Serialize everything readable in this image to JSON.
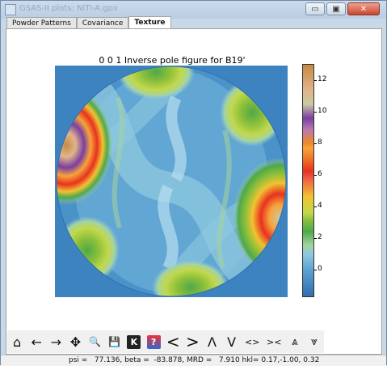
{
  "window": {
    "title": "GSAS-II plots: NiTi-A.gpx",
    "buttons": {
      "minimize": "▭",
      "maximize": "▣",
      "close": "✕"
    }
  },
  "tabs": [
    {
      "label": "Powder Patterns",
      "active": false
    },
    {
      "label": "Covariance",
      "active": false
    },
    {
      "label": "Texture",
      "active": true
    }
  ],
  "plot": {
    "title": "0 0 1 Inverse pole figure for B19'",
    "colorbar": {
      "ticks": [
        "0",
        "2",
        "4",
        "6",
        "8",
        "10",
        "12"
      ],
      "colors": {
        "low": "#2f6fb0",
        "mid_low": "#8fc8df",
        "green": "#4fa84a",
        "yellow": "#f1c232",
        "red": "#e8321f",
        "orange": "#f07d29",
        "purple": "#7b3fa0",
        "high": "#c68a46"
      }
    }
  },
  "toolbar": {
    "items": [
      {
        "name": "home-icon",
        "glyph": "⌂"
      },
      {
        "name": "back-icon",
        "glyph": "←"
      },
      {
        "name": "forward-icon",
        "glyph": "→"
      },
      {
        "name": "pan-icon",
        "glyph": "✥"
      },
      {
        "name": "zoom-icon",
        "glyph": "🔍"
      },
      {
        "name": "save-icon",
        "glyph": "💾"
      },
      {
        "name": "k-icon",
        "glyph": "K"
      },
      {
        "name": "help-icon",
        "glyph": "?"
      },
      {
        "name": "shift-left-icon",
        "glyph": "<"
      },
      {
        "name": "shift-right-icon",
        "glyph": ">"
      },
      {
        "name": "shift-up-icon",
        "glyph": "Λ"
      },
      {
        "name": "shift-down-icon",
        "glyph": "V"
      },
      {
        "name": "expand-horizontal-icon",
        "glyph": "<>"
      },
      {
        "name": "contract-horizontal-icon",
        "glyph": "><"
      },
      {
        "name": "expand-vertical-icon",
        "glyph": "⩓"
      },
      {
        "name": "contract-vertical-icon",
        "glyph": "⩔"
      }
    ]
  },
  "status": {
    "text": "psi =   77.136, beta =  -83.878, MRD =   7.910 hkl= 0.17,-1.00, 0.32"
  }
}
